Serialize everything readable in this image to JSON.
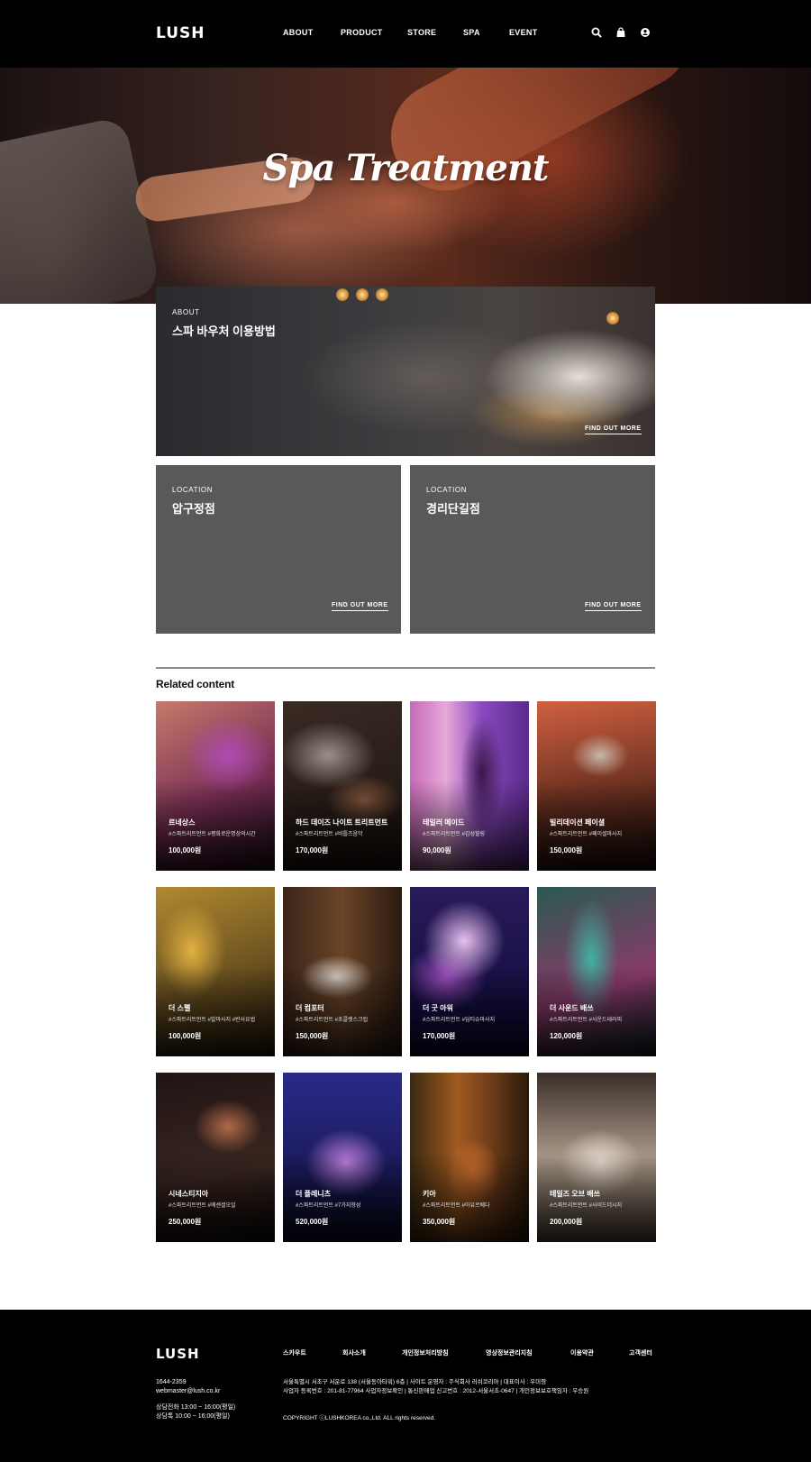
{
  "header": {
    "logo": "LUSH",
    "nav": [
      "ABOUT",
      "PRODUCT",
      "STORE",
      "SPA",
      "EVENT"
    ],
    "icons": [
      "search-icon",
      "shopping-bag-icon",
      "user-icon"
    ]
  },
  "hero": {
    "title": "Spa Treatment"
  },
  "about_card": {
    "eyebrow": "ABOUT",
    "title": "스파 바우처 이용방법",
    "link": "FIND OUT MORE"
  },
  "locations": [
    {
      "eyebrow": "LOCATION",
      "title": "압구정점",
      "link": "FIND OUT MORE"
    },
    {
      "eyebrow": "LOCATION",
      "title": "경리단길점",
      "link": "FIND OUT MORE"
    }
  ],
  "related": {
    "title": "Related content",
    "items": [
      {
        "name": "르네상스",
        "tags": "#스파트리트먼트 #평화로운명상의시간",
        "price": "100,000원"
      },
      {
        "name": "하드 데이즈 나이트 트리트먼트",
        "tags": "#스파트리트먼트 #비틀즈음악",
        "price": "170,000원"
      },
      {
        "name": "테일러 메이드",
        "tags": "#스파트리트먼트 #감성힐링",
        "price": "90,000원"
      },
      {
        "name": "빌리데이션 페이셜",
        "tags": "#스파트리트먼트 #페이셜마사지",
        "price": "150,000원"
      },
      {
        "name": "더 스펠",
        "tags": "#스파트리트먼트 #발마사지 #반사요법",
        "price": "100,000원"
      },
      {
        "name": "더 컴포터",
        "tags": "#스파트리트먼트 #초콜렛스크럽",
        "price": "150,000원"
      },
      {
        "name": "더 굿 아워",
        "tags": "#스파트리트먼트 #딥티슈마사지",
        "price": "170,000원"
      },
      {
        "name": "더 사운드 배쓰",
        "tags": "#스파트리트먼트 #사운드테라피",
        "price": "120,000원"
      },
      {
        "name": "시네스티지아",
        "tags": "#스파트리트먼트 #에센셜오일",
        "price": "250,000원"
      },
      {
        "name": "더 플레니츠",
        "tags": "#스파트리트먼트 #7가지향성",
        "price": "520,000원"
      },
      {
        "name": "키아",
        "tags": "#스파트리트먼트 #아유르베다",
        "price": "350,000원"
      },
      {
        "name": "테일즈 오브 배쓰",
        "tags": "#스파트리트먼트 #사이드더시지",
        "price": "200,000원"
      }
    ]
  },
  "footer": {
    "logo": "LUSH",
    "links": [
      "스카우트",
      "회사소개",
      "개인정보처리방침",
      "영상정보관리지침",
      "이용약관",
      "고객센터"
    ],
    "phone": "1644-2359",
    "email": "webmaster@lush.co.kr",
    "hours_phone": "상담전화 13:00 ~ 16:00(평일)",
    "hours_chat": "상담톡 10:00 ~ 16:00(평일)",
    "address_line1": "서울특별시 서초구 서운로 138 (서울동아타워) 6층 | 사이트 운영자 : 주식회사 러쉬코리아 | 대표이사 : 우미령",
    "address_line2": "사업자 등록번호 : 201-81-77964 사업자정보확인 | 통신판매업 신고번호 : 2012-서울서초-0647 | 개인정보보호책임자 : 우승원",
    "copyright": "COPYRIGHT ⓒLUSHKOREA co.,Ltd. ALL rights reserved."
  },
  "colors": {
    "header_bg": "#000000",
    "location_card_bg": "#595959",
    "footer_bg": "#000000",
    "rule": "#8a8a8a"
  }
}
